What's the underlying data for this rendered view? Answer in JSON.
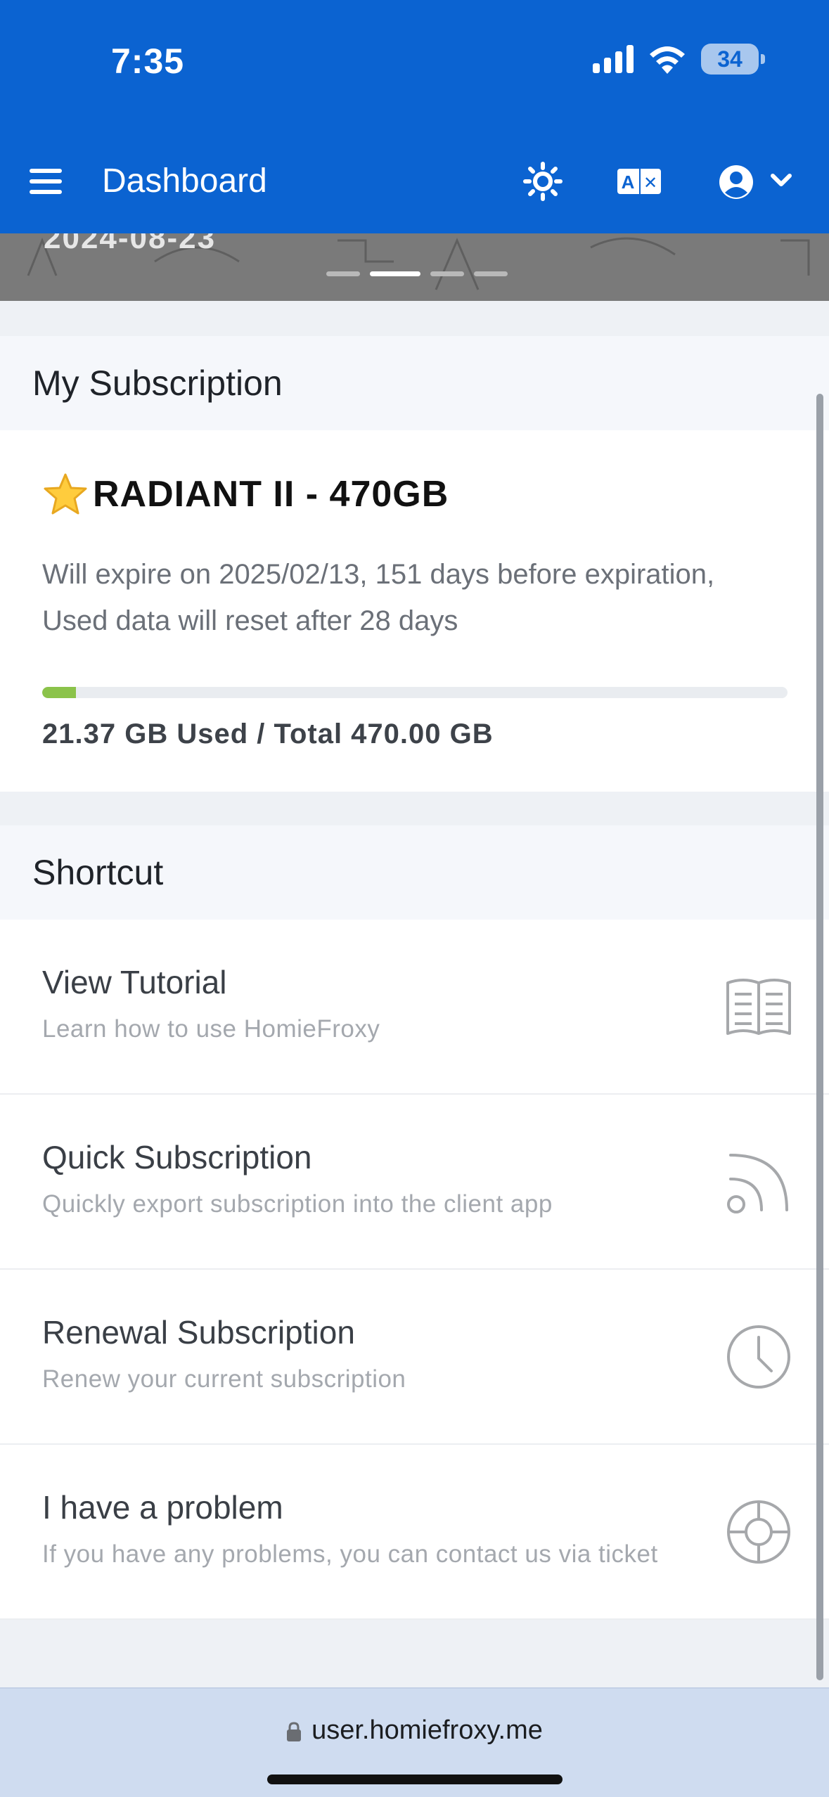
{
  "status_bar": {
    "time": "7:35",
    "battery": "34"
  },
  "header": {
    "title": "Dashboard"
  },
  "banner": {
    "date_text": "2024-08-23",
    "slides": 4,
    "active_slide": 2
  },
  "subscription": {
    "section_title": "My Subscription",
    "plan_name": "RADIANT II - 470GB",
    "expiry_text": "Will expire on 2025/02/13, 151 days before expiration, Used data will reset after 28 days",
    "usage_text": "21.37 GB Used / Total 470.00 GB",
    "used_gb": 21.37,
    "total_gb": 470.0,
    "progress_color": "#8bc34a"
  },
  "shortcut": {
    "section_title": "Shortcut",
    "items": [
      {
        "title": "View Tutorial",
        "subtitle": "Learn how to use HomieFroxy",
        "icon": "book-icon"
      },
      {
        "title": "Quick Subscription",
        "subtitle": "Quickly export subscription into the client app",
        "icon": "rss-icon"
      },
      {
        "title": "Renewal Subscription",
        "subtitle": "Renew your current subscription",
        "icon": "clock-icon"
      },
      {
        "title": "I have a problem",
        "subtitle": "If you have any problems, you can contact us via ticket",
        "icon": "lifebuoy-icon"
      }
    ]
  },
  "browser": {
    "url": "user.homiefroxy.me"
  },
  "colors": {
    "header_blue": "#0b63d1",
    "accent_green": "#8bc34a"
  }
}
